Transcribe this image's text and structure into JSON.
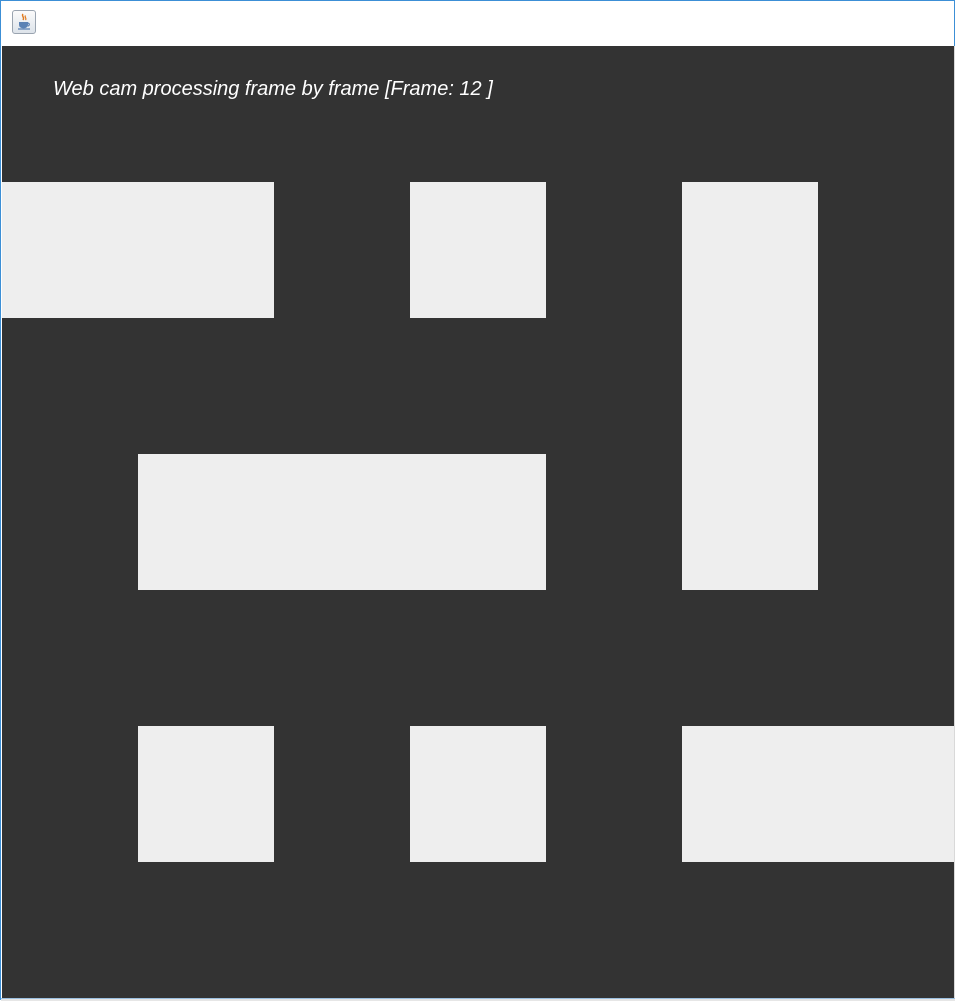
{
  "window": {
    "icon": "java-cup-icon",
    "title": ""
  },
  "canvas": {
    "label": "Web cam processing frame by frame [Frame: 12 ]",
    "background_color": "#333333",
    "block_color": "#eeeeee"
  }
}
